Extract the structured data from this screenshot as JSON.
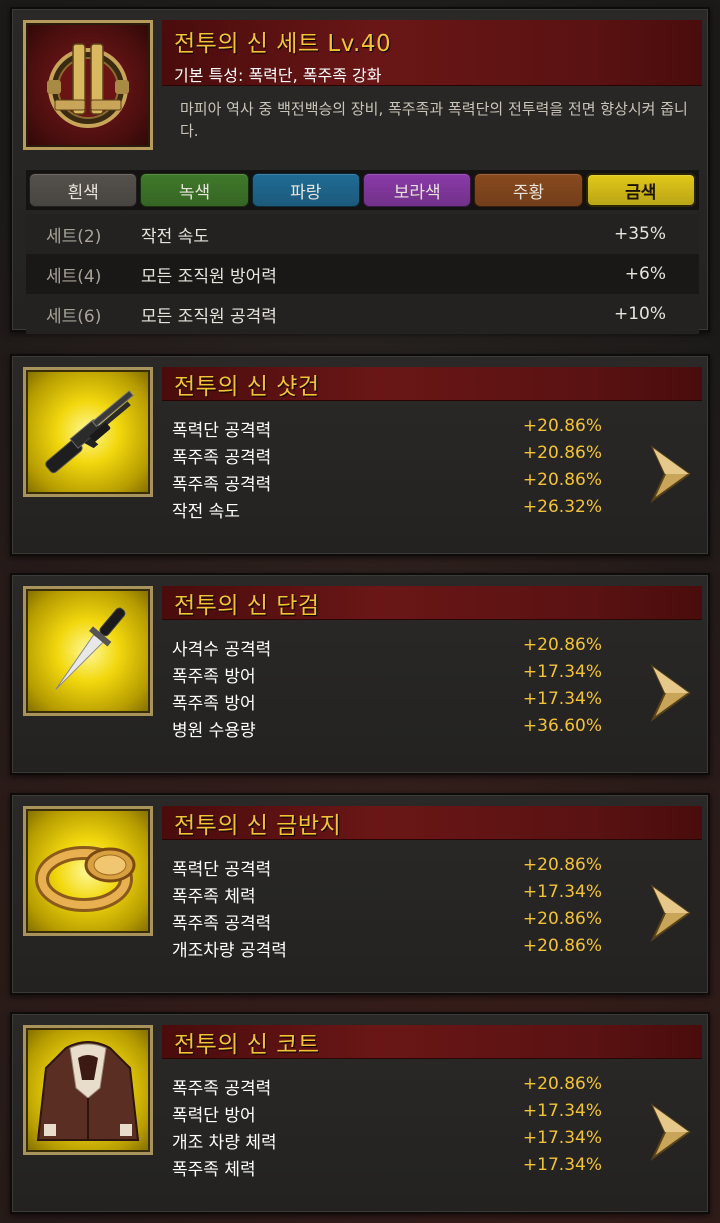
{
  "set": {
    "title": "전투의 신 세트 Lv.40",
    "subtitle": "기본 특성: 폭력단, 폭주족 강화",
    "description": "마피아 역사 중 백전백승의 장비, 폭주족과 폭력단의 전투력을 전면 향상시켜 줍니다.",
    "icon": "gold-guns-emblem-icon",
    "grades": [
      {
        "label": "흰색",
        "color": "#55524d"
      },
      {
        "label": "녹색",
        "color": "#3f7a2a"
      },
      {
        "label": "파랑",
        "color": "#1f6c96"
      },
      {
        "label": "보라색",
        "color": "#8a3aa8"
      },
      {
        "label": "주황",
        "color": "#8a4a1e"
      },
      {
        "label": "금색",
        "color": "#e2c818",
        "active": true
      }
    ],
    "bonuses": [
      {
        "level": "세트(2)",
        "name": "작전 속도",
        "value": "+35%"
      },
      {
        "level": "세트(4)",
        "name": "모든 조직원 방어력",
        "value": "+6%"
      },
      {
        "level": "세트(6)",
        "name": "모든 조직원 공격력",
        "value": "+10%"
      }
    ]
  },
  "items": [
    {
      "name": "전투의 신 샷건",
      "icon": "shotgun-icon",
      "stats": [
        {
          "name": "폭력단 공격력",
          "value": "+20.86%"
        },
        {
          "name": "폭주족 공격력",
          "value": "+20.86%"
        },
        {
          "name": "폭주족 공격력",
          "value": "+20.86%"
        },
        {
          "name": "작전 속도",
          "value": "+26.32%"
        }
      ]
    },
    {
      "name": "전투의 신 단검",
      "icon": "dagger-icon",
      "stats": [
        {
          "name": "사격수 공격력",
          "value": "+20.86%"
        },
        {
          "name": "폭주족 방어",
          "value": "+17.34%"
        },
        {
          "name": "폭주족 방어",
          "value": "+17.34%"
        },
        {
          "name": "병원 수용량",
          "value": "+36.60%"
        }
      ]
    },
    {
      "name": "전투의 신 금반지",
      "icon": "gold-ring-icon",
      "stats": [
        {
          "name": "폭력단 공격력",
          "value": "+20.86%"
        },
        {
          "name": "폭주족 체력",
          "value": "+17.34%"
        },
        {
          "name": "폭주족 공격력",
          "value": "+20.86%"
        },
        {
          "name": "개조차량 공격력",
          "value": "+20.86%"
        }
      ]
    },
    {
      "name": "전투의 신 코트",
      "icon": "leather-coat-icon",
      "stats": [
        {
          "name": "폭주족 공격력",
          "value": "+20.86%"
        },
        {
          "name": "폭력단 방어",
          "value": "+17.34%"
        },
        {
          "name": "개조 차량 체력",
          "value": "+17.34%"
        },
        {
          "name": "폭주족 체력",
          "value": "+17.34%"
        }
      ]
    }
  ]
}
